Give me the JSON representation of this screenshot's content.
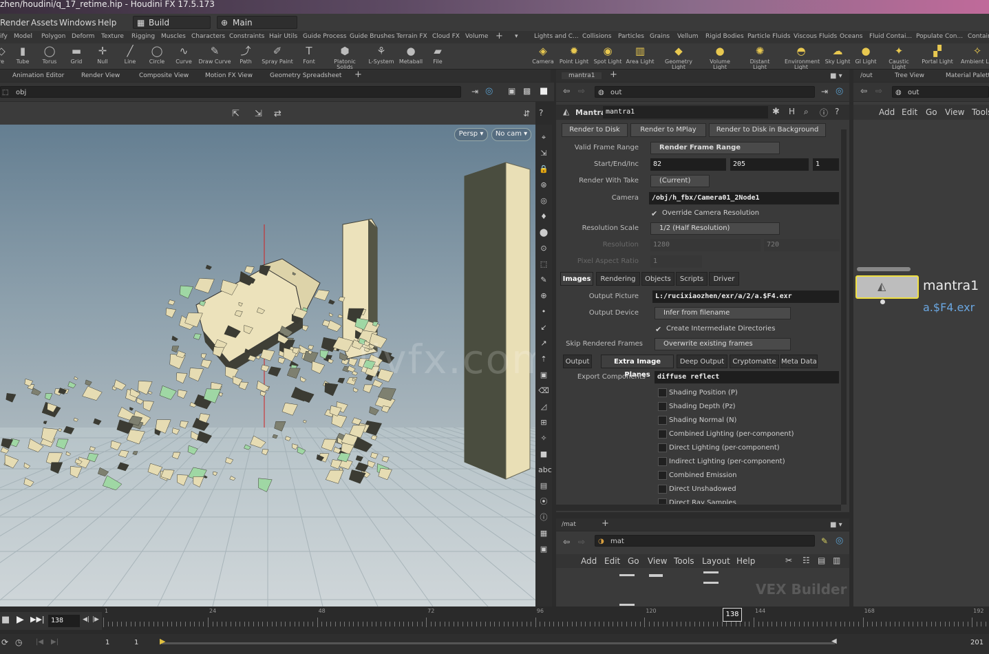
{
  "window": {
    "title": "zhen/houdini/q_17_retime.hip - Houdini FX 17.5.173"
  },
  "menu": {
    "items": [
      "Render",
      "Assets",
      "Windows",
      "Help"
    ],
    "desktop": "Build",
    "main": "Main"
  },
  "shelf_tabs_left": [
    "ify",
    "Model",
    "Polygon",
    "Deform",
    "Texture",
    "Rigging",
    "Muscles",
    "Characters",
    "Constraints",
    "Hair Utils",
    "Guide Process",
    "Guide Brushes",
    "Terrain FX",
    "Cloud FX",
    "Volume"
  ],
  "shelf_tabs_right": [
    "Lights and C...",
    "Collisions",
    "Particles",
    "Grains",
    "Vellum",
    "Rigid Bodies",
    "Particle Fluids",
    "Viscous Fluids",
    "Oceans",
    "Fluid Contai...",
    "Populate Con...",
    "Contain"
  ],
  "tools_left": [
    {
      "label": "re",
      "icon": "◇"
    },
    {
      "label": "Tube",
      "icon": "▮"
    },
    {
      "label": "Torus",
      "icon": "◯"
    },
    {
      "label": "Grid",
      "icon": "▬"
    },
    {
      "label": "Null",
      "icon": "✛"
    },
    {
      "label": "Line",
      "icon": "╱"
    },
    {
      "label": "Circle",
      "icon": "◯"
    },
    {
      "label": "Curve",
      "icon": "∿"
    },
    {
      "label": "Draw Curve",
      "icon": "✎"
    },
    {
      "label": "Path",
      "icon": "⤴"
    },
    {
      "label": "Spray Paint",
      "icon": "✐"
    },
    {
      "label": "Font",
      "icon": "T"
    },
    {
      "label": "Platonic Solids",
      "icon": "⬢"
    },
    {
      "label": "L-System",
      "icon": "⚘"
    },
    {
      "label": "Metaball",
      "icon": "●"
    },
    {
      "label": "File",
      "icon": "▰"
    }
  ],
  "tools_right": [
    {
      "label": "Camera",
      "icon": "◈"
    },
    {
      "label": "Point Light",
      "icon": "✹"
    },
    {
      "label": "Spot Light",
      "icon": "◉"
    },
    {
      "label": "Area Light",
      "icon": "▥"
    },
    {
      "label": "Geometry Light",
      "icon": "◆"
    },
    {
      "label": "Volume Light",
      "icon": "●"
    },
    {
      "label": "Distant Light",
      "icon": "✺"
    },
    {
      "label": "Environment Light",
      "icon": "◓"
    },
    {
      "label": "Sky Light",
      "icon": "☁"
    },
    {
      "label": "GI Light",
      "icon": "●"
    },
    {
      "label": "Caustic Light",
      "icon": "✦"
    },
    {
      "label": "Portal Light",
      "icon": "▞"
    },
    {
      "label": "Ambient Lig",
      "icon": "✧"
    }
  ],
  "viewer_tabs": [
    "Animation Editor",
    "Render View",
    "Composite View",
    "Motion FX View",
    "Geometry Spreadsheet"
  ],
  "viewer_path": "obj",
  "viewport": {
    "persp": "Persp ▾",
    "cam": "No cam ▾"
  },
  "mantra_tab": "mantra1",
  "mantra_path": "out",
  "mantra": {
    "type": "Mantra",
    "name": "mantra1",
    "buttons": [
      "Render to Disk",
      "Render to MPlay",
      "Render to Disk in Background"
    ],
    "valid_frame_range_label": "Valid Frame Range",
    "valid_frame_range": "Render Frame Range",
    "start_end_inc_label": "Start/End/Inc",
    "start": "82",
    "end": "205",
    "inc": "1",
    "render_with_take_label": "Render With Take",
    "render_with_take": "(Current)",
    "camera_label": "Camera",
    "camera": "/obj/h_fbx/Camera01_2Node1",
    "override_res": "Override Camera Resolution",
    "res_scale_label": "Resolution Scale",
    "res_scale": "1/2 (Half Resolution)",
    "resolution_label": "Resolution",
    "resolution_x": "1280",
    "resolution_y": "720",
    "pixel_aspect_label": "Pixel Aspect Ratio",
    "pixel_aspect": "1",
    "tabs": [
      "Images",
      "Rendering",
      "Objects",
      "Scripts",
      "Driver"
    ],
    "output_picture_label": "Output Picture",
    "output_picture": "L:/rucixiaozhen/exr/a/2/a.$F4.exr",
    "output_device_label": "Output Device",
    "output_device": "Infer from filename",
    "create_dirs": "Create Intermediate Directories",
    "skip_frames_label": "Skip Rendered Frames",
    "skip_frames": "Overwrite existing frames",
    "subtabs": [
      "Output",
      "Extra Image Planes",
      "Deep Output",
      "Cryptomatte",
      "Meta Data"
    ],
    "export_label": "Export Components",
    "export_value": "diffuse reflect",
    "planes": [
      "Shading Position (P)",
      "Shading Depth (Pz)",
      "Shading Normal (N)",
      "Combined Lighting (per-component)",
      "Direct Lighting (per-component)",
      "Indirect Lighting (per-component)",
      "Combined Emission",
      "Direct Unshadowed",
      "Direct Ray Samples"
    ]
  },
  "net_right": {
    "tabs": [
      "/out",
      "Tree View",
      "Material Palett"
    ],
    "path": "out",
    "menu": [
      "Add",
      "Edit",
      "Go",
      "View",
      "Tools"
    ],
    "node_name": "mantra1",
    "node_file": "a.$F4.exr"
  },
  "mat": {
    "tab": "/mat",
    "path": "mat",
    "menu": [
      "Add",
      "Edit",
      "Go",
      "View",
      "Tools",
      "Layout",
      "Help"
    ],
    "context": "VEX Builder"
  },
  "timeline": {
    "frame": "138",
    "marker": "138",
    "ticks": [
      "1",
      "24",
      "48",
      "72",
      "96",
      "120",
      "144",
      "168",
      "192"
    ],
    "start1": "1",
    "start2": "1",
    "end": "201"
  },
  "watermark": "livfx.com"
}
